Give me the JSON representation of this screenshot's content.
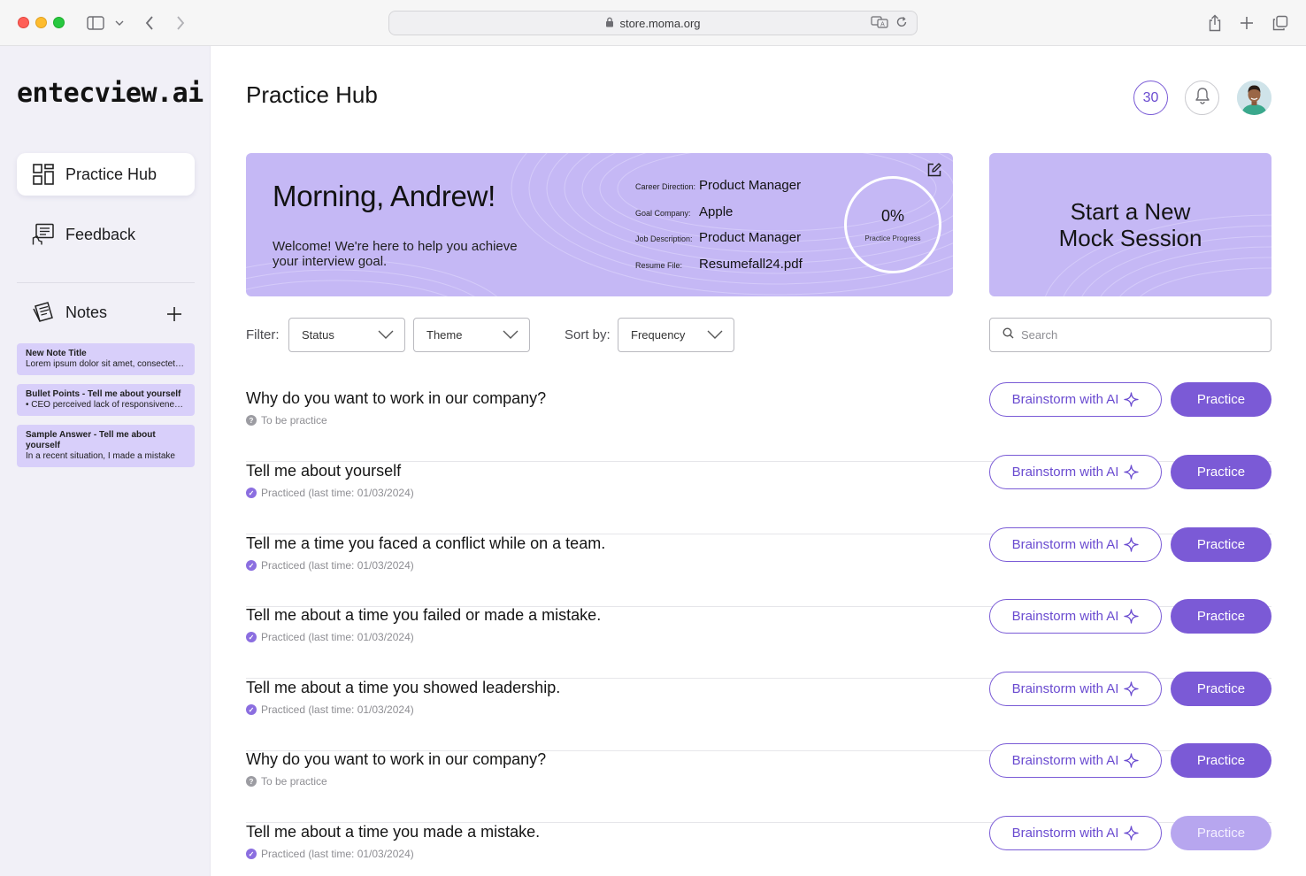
{
  "browser": {
    "url": "store.moma.org"
  },
  "app": {
    "logo_text": "entecview.ai"
  },
  "sidebar": {
    "nav": [
      {
        "label": "Practice Hub",
        "icon": "grid-icon",
        "active": true
      },
      {
        "label": "Feedback",
        "icon": "feedback-icon",
        "active": false
      }
    ],
    "notes_label": "Notes",
    "notes": [
      {
        "title": "New Note Title",
        "body": "Lorem ipsum dolor sit amet, consectetur..."
      },
      {
        "title": "Bullet Points - Tell me about yourself",
        "body": "•  CEO perceived lack of responsivenes..."
      },
      {
        "title": "Sample Answer - Tell me about yourself",
        "body": "In a recent situation, I made a mistake"
      }
    ]
  },
  "header": {
    "title": "Practice Hub",
    "count_badge": "30"
  },
  "hero": {
    "greeting": "Morning, Andrew!",
    "subtitle": "Welcome! We're here to help you achieve your interview goal.",
    "info": [
      {
        "label": "Career Direction:",
        "value": "Product Manager"
      },
      {
        "label": "Goal Company:",
        "value": "Apple"
      },
      {
        "label": "Job Description:",
        "value": "Product Manager"
      },
      {
        "label": "Resume File:",
        "value": "Resumefall24.pdf"
      }
    ],
    "progress_value": "0%",
    "progress_label": "Practice Progress",
    "progress_fraction": 0
  },
  "mock": {
    "title": "Start a New Mock Session"
  },
  "filters": {
    "filter_label": "Filter:",
    "status": "Status",
    "theme": "Theme",
    "sort_label": "Sort by:",
    "sort": "Frequency",
    "search_placeholder": "Search"
  },
  "buttons": {
    "brainstorm": "Brainstorm with AI",
    "practice": "Practice"
  },
  "questions": [
    {
      "title": "Why do you want to work in our company?",
      "status": "To be practice",
      "done": false
    },
    {
      "title": "Tell me about yourself",
      "status": "Practiced (last time: 01/03/2024)",
      "done": true
    },
    {
      "title": "Tell me a time you faced a conflict while on a team.",
      "status": "Practiced (last time: 01/03/2024)",
      "done": true
    },
    {
      "title": "Tell me about a time you failed or made a mistake.",
      "status": "Practiced (last time: 01/03/2024)",
      "done": true
    },
    {
      "title": "Tell me about a time you showed leadership.",
      "status": "Practiced (last time: 01/03/2024)",
      "done": true
    },
    {
      "title": "Why do you want to work in our company?",
      "status": "To be practice",
      "done": false
    },
    {
      "title": "Tell me about a time you made a mistake.",
      "status": "Practiced (last time: 01/03/2024)",
      "done": true
    }
  ],
  "colors": {
    "accent": "#7b5ad6",
    "card_bg": "#c5b8f5",
    "sidebar_bg": "#f1f0f7",
    "note_bg": "#d8cffa"
  }
}
